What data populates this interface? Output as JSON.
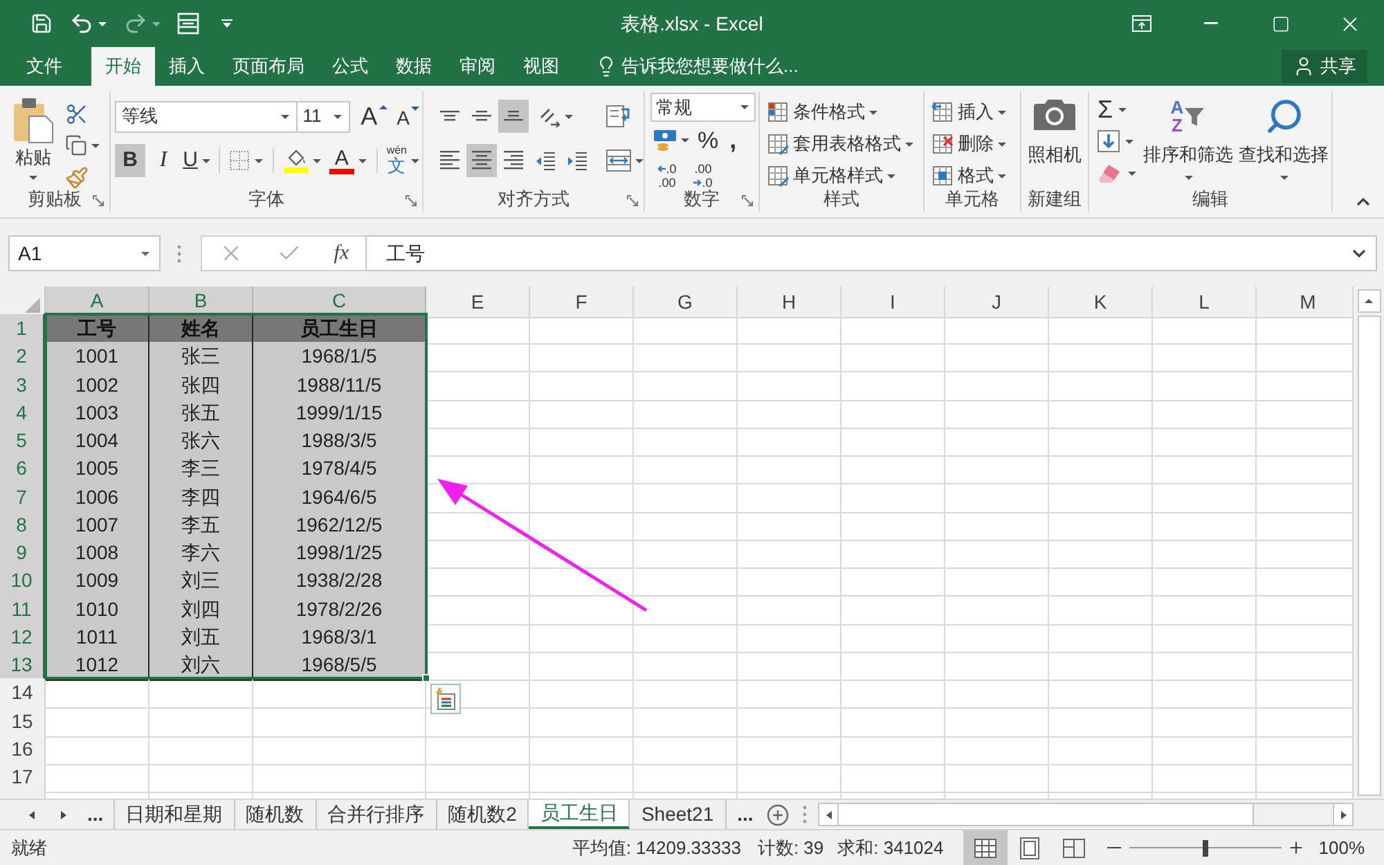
{
  "window": {
    "title": "表格.xlsx - Excel"
  },
  "quick_access": [
    {
      "kind": "save",
      "disabled": false
    },
    {
      "kind": "undo",
      "disabled": false
    },
    {
      "kind": "redo",
      "disabled": true
    },
    {
      "kind": "form",
      "disabled": false
    }
  ],
  "ribbon_tabs": [
    {
      "label": "文件",
      "selected": false
    },
    {
      "label": "开始",
      "selected": true
    },
    {
      "label": "插入",
      "selected": false
    },
    {
      "label": "页面布局",
      "selected": false
    },
    {
      "label": "公式",
      "selected": false
    },
    {
      "label": "数据",
      "selected": false
    },
    {
      "label": "审阅",
      "selected": false
    },
    {
      "label": "视图",
      "selected": false
    }
  ],
  "tell_me": {
    "placeholder": "告诉我您想要做什么..."
  },
  "share_button": {
    "label": "共享"
  },
  "ribbon": {
    "clipboard": {
      "label": "剪贴板",
      "paste": "粘贴"
    },
    "font": {
      "label": "字体",
      "font_name": "等线",
      "font_size": "11",
      "grow_font": "A",
      "shrink_font": "A",
      "bold": {
        "glyph": "B",
        "on": true
      },
      "italic": {
        "glyph": "I",
        "on": false
      },
      "underline": {
        "glyph": "U",
        "on": false
      },
      "font_color": "A",
      "phonetic": {
        "reading": "wén",
        "glyph": "文"
      }
    },
    "alignment": {
      "label": "对齐方式",
      "vertical": [
        {
          "kind": "top",
          "selected": false
        },
        {
          "kind": "middle",
          "selected": false
        },
        {
          "kind": "bottom",
          "selected": true
        }
      ],
      "horizontal": [
        {
          "kind": "left",
          "selected": false
        },
        {
          "kind": "center",
          "selected": true
        },
        {
          "kind": "right",
          "selected": false
        }
      ]
    },
    "number": {
      "label": "数字",
      "format": "常规",
      "percent": "%",
      "comma": ",",
      "increase_decimal": [
        ".0",
        ".00"
      ],
      "decrease_decimal": [
        ".00",
        ".0"
      ]
    },
    "styles": {
      "label": "样式",
      "items": [
        {
          "kind": "conditional",
          "label": "条件格式"
        },
        {
          "kind": "table",
          "label": "套用表格格式"
        },
        {
          "kind": "cell",
          "label": "单元格样式"
        }
      ]
    },
    "cells": {
      "label": "单元格",
      "items": [
        {
          "kind": "insert",
          "label": "插入"
        },
        {
          "kind": "delete",
          "label": "删除"
        },
        {
          "kind": "format",
          "label": "格式"
        }
      ]
    },
    "new_group": {
      "label": "新建组",
      "camera": "照相机"
    },
    "editing": {
      "label": "编辑",
      "autosum": "Σ",
      "sort": {
        "letters": [
          "A",
          "Z"
        ],
        "label": "排序和筛选"
      },
      "find": "查找和选择"
    }
  },
  "formula_bar": {
    "name_box": "A1",
    "fx": "fx",
    "value": "工号"
  },
  "sheet": {
    "columns": [
      {
        "label": "A",
        "selected": true
      },
      {
        "label": "B",
        "selected": true
      },
      {
        "label": "C",
        "selected": true
      },
      {
        "label": "E",
        "selected": false
      },
      {
        "label": "F",
        "selected": false
      },
      {
        "label": "G",
        "selected": false
      },
      {
        "label": "H",
        "selected": false
      },
      {
        "label": "I",
        "selected": false
      },
      {
        "label": "J",
        "selected": false
      },
      {
        "label": "K",
        "selected": false
      },
      {
        "label": "L",
        "selected": false
      },
      {
        "label": "M",
        "selected": false
      }
    ],
    "rows": [
      {
        "label": "1",
        "selected": true,
        "kind": "header",
        "cells": [
          "工号",
          "姓名",
          "员工生日"
        ]
      },
      {
        "label": "2",
        "selected": true,
        "kind": "data",
        "cells": [
          "1001",
          "张三",
          "1968/1/5"
        ]
      },
      {
        "label": "3",
        "selected": true,
        "kind": "data",
        "cells": [
          "1002",
          "张四",
          "1988/11/5"
        ]
      },
      {
        "label": "4",
        "selected": true,
        "kind": "data",
        "cells": [
          "1003",
          "张五",
          "1999/1/15"
        ]
      },
      {
        "label": "5",
        "selected": true,
        "kind": "data",
        "cells": [
          "1004",
          "张六",
          "1988/3/5"
        ]
      },
      {
        "label": "6",
        "selected": true,
        "kind": "data",
        "cells": [
          "1005",
          "李三",
          "1978/4/5"
        ]
      },
      {
        "label": "7",
        "selected": true,
        "kind": "data",
        "cells": [
          "1006",
          "李四",
          "1964/6/5"
        ]
      },
      {
        "label": "8",
        "selected": true,
        "kind": "data",
        "cells": [
          "1007",
          "李五",
          "1962/12/5"
        ]
      },
      {
        "label": "9",
        "selected": true,
        "kind": "data",
        "cells": [
          "1008",
          "李六",
          "1998/1/25"
        ]
      },
      {
        "label": "10",
        "selected": true,
        "kind": "data",
        "cells": [
          "1009",
          "刘三",
          "1938/2/28"
        ]
      },
      {
        "label": "11",
        "selected": true,
        "kind": "data",
        "cells": [
          "1010",
          "刘四",
          "1978/2/26"
        ]
      },
      {
        "label": "12",
        "selected": true,
        "kind": "data",
        "cells": [
          "1011",
          "刘五",
          "1968/3/1"
        ]
      },
      {
        "label": "13",
        "selected": true,
        "kind": "data",
        "cells": [
          "1012",
          "刘六",
          "1968/5/5"
        ]
      },
      {
        "label": "14",
        "selected": false
      },
      {
        "label": "15",
        "selected": false
      },
      {
        "label": "16",
        "selected": false
      },
      {
        "label": "17",
        "selected": false
      }
    ]
  },
  "sheet_tabs": {
    "overflow_left": "...",
    "tabs": [
      {
        "label": "日期和星期",
        "selected": false
      },
      {
        "label": "随机数",
        "selected": false
      },
      {
        "label": "合并行排序",
        "selected": false
      },
      {
        "label": "随机数2",
        "selected": false
      },
      {
        "label": "员工生日",
        "selected": true
      },
      {
        "label": "Sheet21",
        "selected": false
      }
    ],
    "overflow_right": "..."
  },
  "status_bar": {
    "mode": "就绪",
    "average": "平均值: 14209.33333",
    "count": "计数: 39",
    "sum": "求和: 341024",
    "views": [
      {
        "kind": "normal",
        "selected": true
      },
      {
        "kind": "layout",
        "selected": false
      },
      {
        "kind": "break",
        "selected": false
      }
    ],
    "zoom": {
      "level": 0.5,
      "reading": "100%"
    }
  }
}
